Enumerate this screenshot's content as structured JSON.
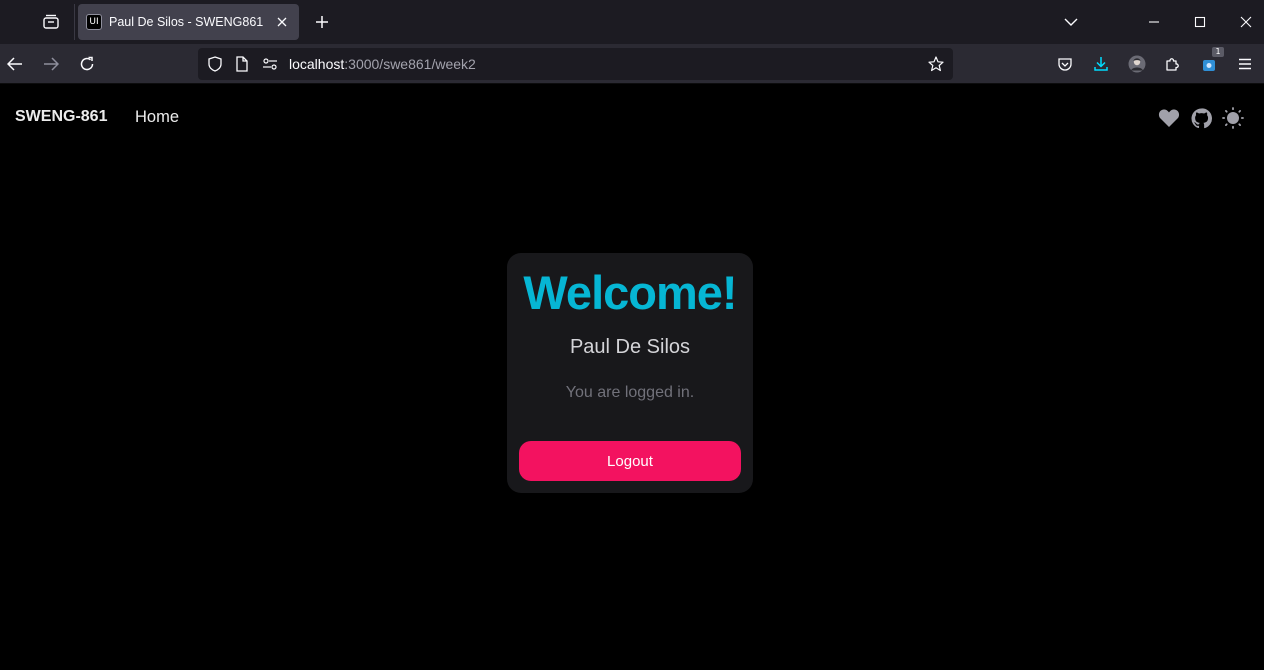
{
  "browser": {
    "tab": {
      "favicon": "UI",
      "title": "Paul De Silos - SWENG861"
    },
    "url": {
      "host": "localhost",
      "path": ":3000/swe861/week2"
    },
    "downloads_badge": "1",
    "icons": {
      "tabs_list": "tabs-list-icon",
      "close_tab": "close-icon",
      "new_tab": "plus-icon",
      "list_all_tabs": "chevron-down-icon",
      "minimize": "minimize-icon",
      "maximize": "maximize-icon",
      "close_window": "close-icon",
      "back": "arrow-left-icon",
      "forward": "arrow-right-icon",
      "reload": "reload-icon",
      "tracking_protection": "shield-icon",
      "page_info": "page-icon",
      "permissions": "permissions-icon",
      "bookmark": "star-icon",
      "pocket": "pocket-icon",
      "downloads": "download-icon",
      "account": "avatar",
      "extensions": "puzzle-icon",
      "extension": "extension-icon",
      "menu": "hamburger-icon"
    },
    "colors": {
      "tabstrip": "#1c1b22",
      "toolbar": "#2b2a33",
      "active_tab": "#42414d",
      "accent": "#00ddff"
    }
  },
  "site": {
    "brand": "SWENG-861",
    "nav_home": "Home",
    "icons": {
      "sponsor": "heart-icon",
      "github": "github-icon",
      "theme": "sun-icon"
    }
  },
  "card": {
    "welcome": "Welcome!",
    "name": "Paul De Silos",
    "status": "You are logged in.",
    "logout_label": "Logout"
  },
  "colors": {
    "welcome": "#06b6d4",
    "logout": "#f31260",
    "card_bg": "#18181b",
    "page_bg": "#000000"
  }
}
